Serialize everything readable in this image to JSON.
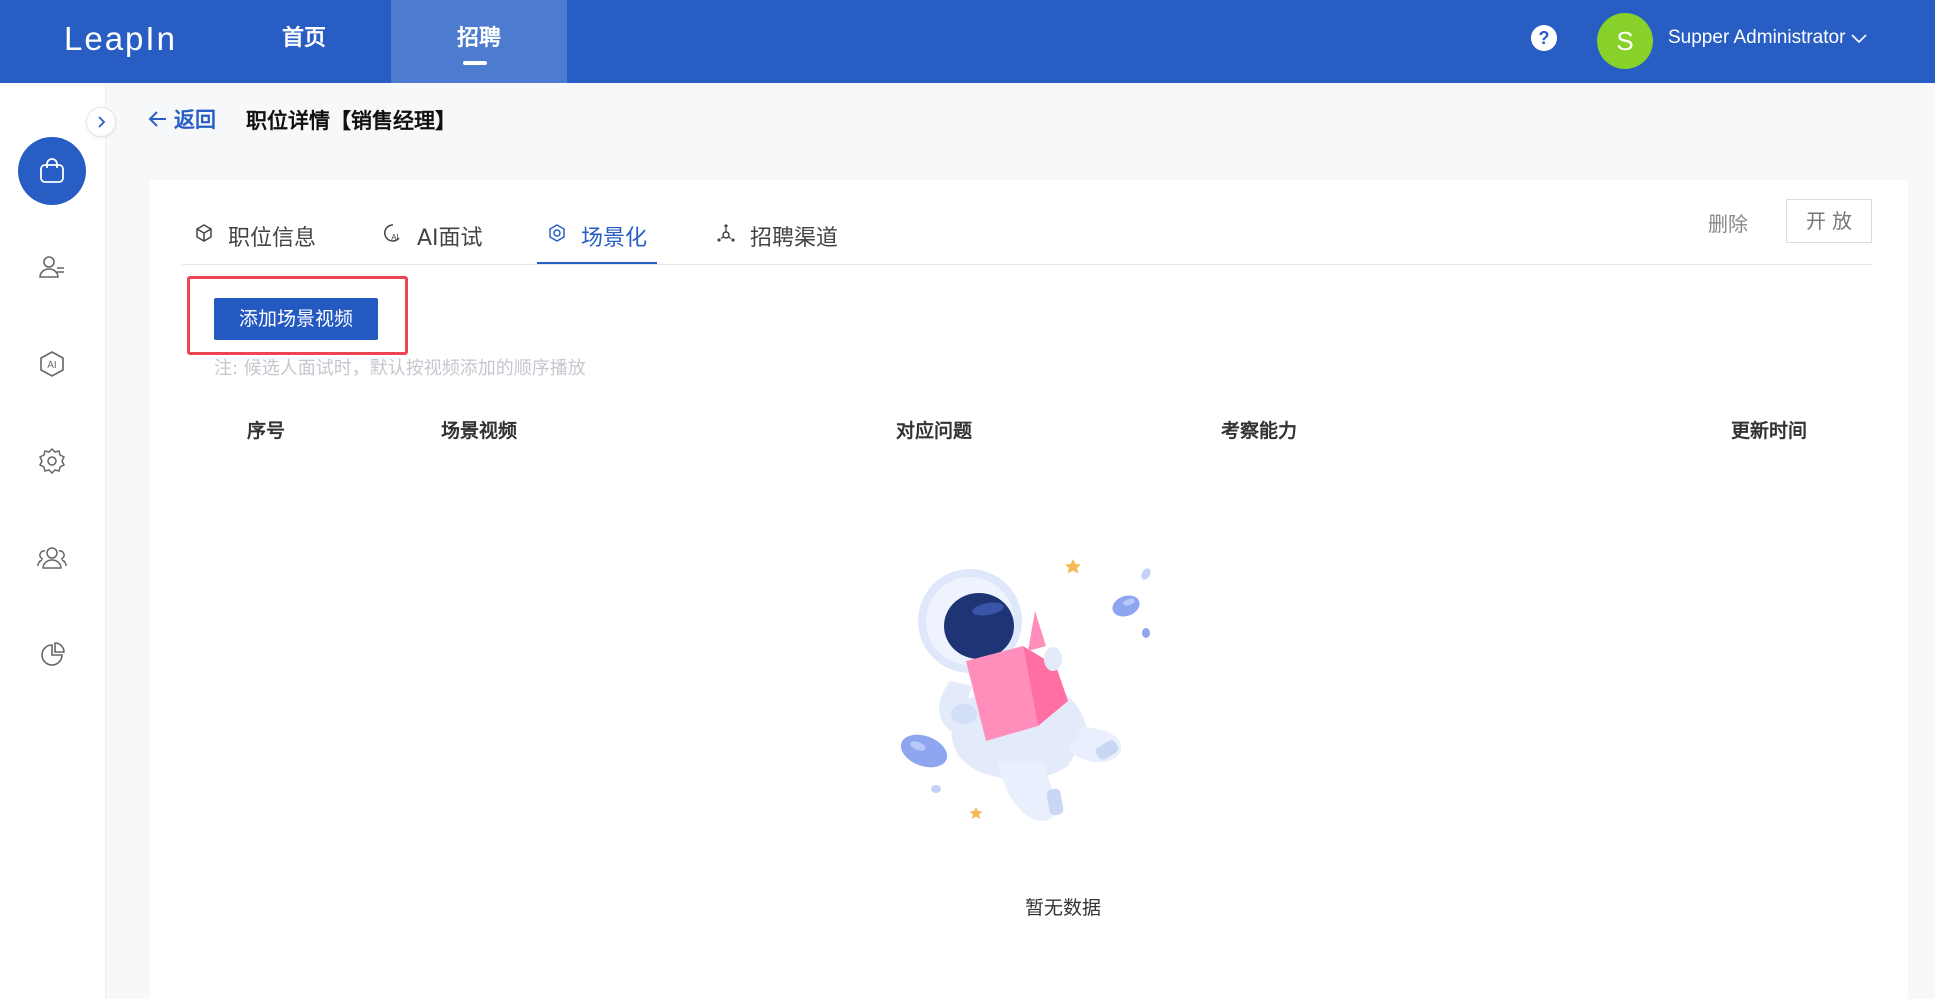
{
  "app": {
    "logo": "LeapIn"
  },
  "nav": {
    "home": "首页",
    "recruit": "招聘"
  },
  "user": {
    "avatar_letter": "S",
    "name": "Supper Administrator",
    "help": "?"
  },
  "header": {
    "back": "返回",
    "title": "职位详情【销售经理】"
  },
  "tabs": [
    {
      "label": "职位信息",
      "icon": "cube-icon"
    },
    {
      "label": "AI面试",
      "icon": "ai-interview-icon"
    },
    {
      "label": "场景化",
      "icon": "scene-icon",
      "active": true
    },
    {
      "label": "招聘渠道",
      "icon": "channel-icon"
    }
  ],
  "actions": {
    "delete": "删除",
    "open": "开放"
  },
  "scene": {
    "add_button": "添加场景视频",
    "note": "注: 候选人面试时，默认按视频添加的顺序播放"
  },
  "table": {
    "columns": [
      "序号",
      "场景视频",
      "对应问题",
      "考察能力",
      "更新时间"
    ],
    "rows": [],
    "empty_text": "暂无数据"
  },
  "colors": {
    "primary": "#285ec3",
    "avatar": "#87d12a",
    "highlight": "#ec4654"
  },
  "sidebar": {
    "items": [
      {
        "icon": "briefcase-icon",
        "active": true
      },
      {
        "icon": "candidates-icon"
      },
      {
        "icon": "ai-icon"
      },
      {
        "icon": "settings-icon"
      },
      {
        "icon": "team-icon"
      },
      {
        "icon": "pie-chart-icon"
      }
    ]
  }
}
